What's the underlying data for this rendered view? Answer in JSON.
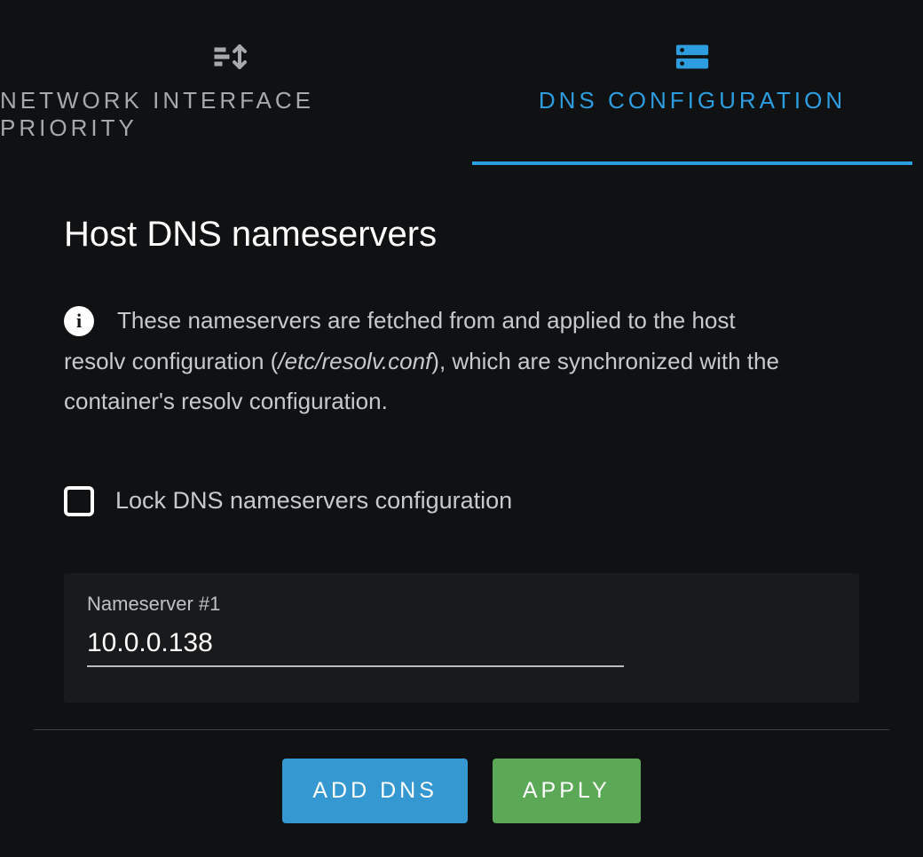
{
  "tabs": {
    "network_priority": {
      "label": "NETWORK INTERFACE PRIORITY",
      "active": false
    },
    "dns_config": {
      "label": "DNS CONFIGURATION",
      "active": true
    }
  },
  "section": {
    "title": "Host DNS nameservers",
    "info_line1": "These nameservers are fetched from and applied to the host",
    "info_line2_pre": "resolv configuration (",
    "info_line2_em": "/etc/resolv.conf",
    "info_line2_post": "), which are synchronized with the",
    "info_line3": "container's resolv configuration."
  },
  "lock_checkbox": {
    "label": "Lock DNS nameservers configuration",
    "checked": false
  },
  "nameservers": [
    {
      "label": "Nameserver #1",
      "value": "10.0.0.138"
    }
  ],
  "buttons": {
    "add_dns": "ADD DNS",
    "apply": "APPLY"
  }
}
